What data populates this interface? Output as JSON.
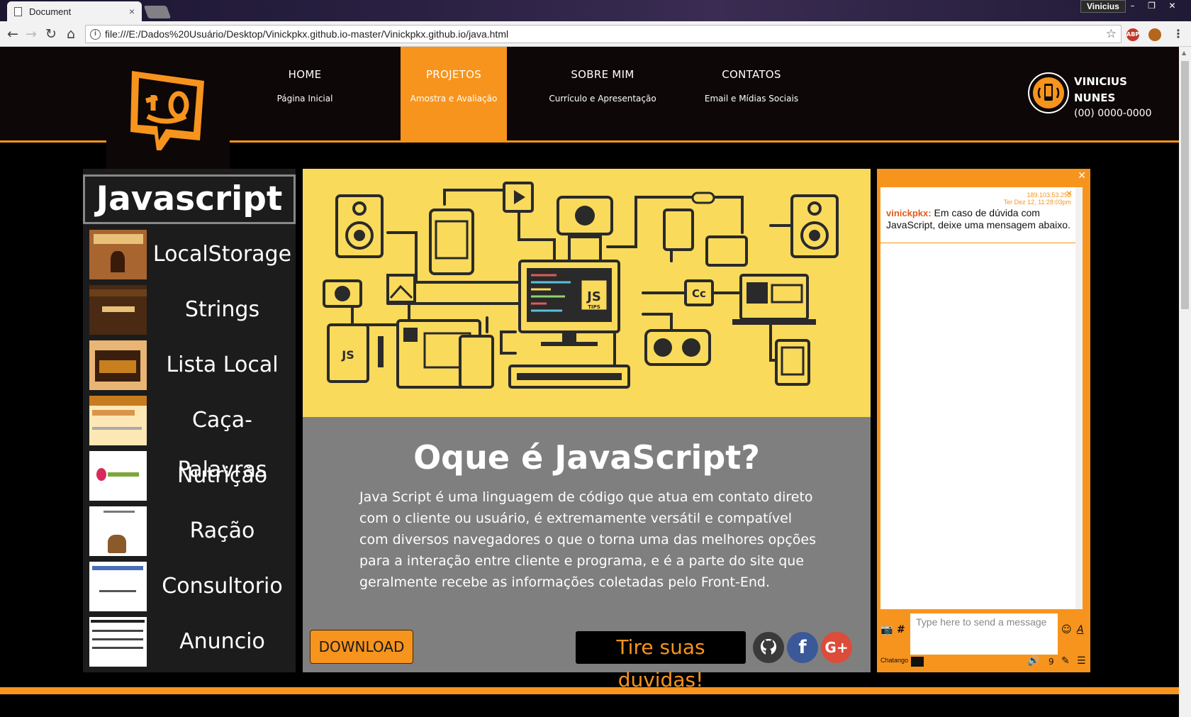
{
  "browser": {
    "tab_title": "Document",
    "tab_close": "×",
    "profile_name": "Vinicius",
    "url": "file:///E:/Dados%20Usuário/Desktop/Vinickpkx.github.io-master/Vinickpkx.github.io/java.html",
    "extension_abp": "ABP"
  },
  "header": {
    "nav": [
      {
        "title": "HOME",
        "subtitle": "Página Inicial"
      },
      {
        "title": "PROJETOS",
        "subtitle": "Amostra e Avaliação"
      },
      {
        "title": "SOBRE MIM",
        "subtitle": "Currículo e Apresentação"
      },
      {
        "title": "CONTATOS",
        "subtitle": "Email e Mídias Sociais"
      }
    ],
    "contact_name": "VINICIUS NUNES",
    "contact_phone": "(00) 0000-0000",
    "colors": {
      "accent": "#f7941d",
      "header_bg": "#0d0707"
    }
  },
  "sidebar": {
    "title": "Javascript",
    "items": [
      {
        "label": "LocalStorage"
      },
      {
        "label": "Strings"
      },
      {
        "label": "Lista Local"
      },
      {
        "label": "Caça-Palavras"
      },
      {
        "label": "Nutrição"
      },
      {
        "label": "Ração"
      },
      {
        "label": "Consultorio"
      },
      {
        "label": "Anuncio"
      }
    ]
  },
  "main": {
    "title": "Oque é JavaScript?",
    "text": "Java Script é uma linguagem de código que atua em contato direto com o cliente ou usuário, é extremamente versátil e compatível com diversos navegadores o que o torna uma das melhores opções para a interação entre cliente e programa, e é a parte do site que geralmente recebe as informações coletadas pelo Front-End.",
    "download_label": "DOWNLOAD",
    "cta_label": "Tire suas duvidas!",
    "hero_badge": "JS",
    "hero_badge_sub": "TIPS",
    "hero_cc": "Cc",
    "social": [
      {
        "icon": "github-icon",
        "color": "#3a3a3a"
      },
      {
        "icon": "facebook-icon",
        "color": "#3b5998",
        "glyph": "f"
      },
      {
        "icon": "google-plus-icon",
        "color": "#dd4b39",
        "glyph": "G+"
      }
    ]
  },
  "chat": {
    "meta_ip": "189.103.53.252",
    "meta_time": "Ter Dez 12, 11:28:03pm",
    "user": "vinickpkx:",
    "message": "Em caso de dúvida com JavaScript, deixe uma mensagem abaixo.",
    "input_placeholder": "Type here to send a message",
    "brand": "Chatango",
    "online_count": "9"
  }
}
